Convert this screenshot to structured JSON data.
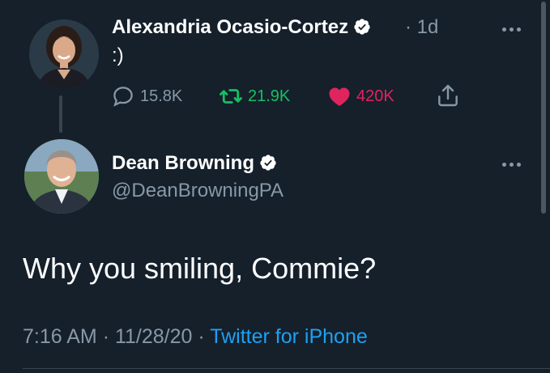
{
  "parent_tweet": {
    "author_name": "Alexandria Ocasio-Cortez",
    "separator": "·",
    "time": "1d",
    "text": ":)",
    "avatar_icon": "avatar-photo",
    "verified_icon": "verified-badge-icon",
    "actions": {
      "replies": "15.8K",
      "retweets": "21.9K",
      "likes": "420K"
    }
  },
  "main_tweet": {
    "author_name": "Dean Browning",
    "handle": "@DeanBrowningPA",
    "text": "Why you smiling, Commie?",
    "time": "7:16 AM",
    "separator_1": "·",
    "date": "11/28/20",
    "separator_2": "·",
    "source": "Twitter for iPhone"
  },
  "colors": {
    "background": "#15202b",
    "muted": "#8899a6",
    "retweet": "#17bf63",
    "like": "#e0245e",
    "link": "#1da1f2"
  }
}
